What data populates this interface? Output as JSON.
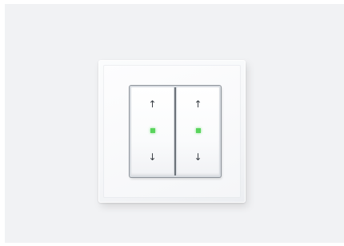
{
  "switch": {
    "rockers": [
      {
        "up_symbol": "↑",
        "down_symbol": "↓",
        "led_color": "#59d45c"
      },
      {
        "up_symbol": "↑",
        "down_symbol": "↓",
        "led_color": "#59d45c"
      }
    ],
    "frame_color": "#f6f7f9",
    "background_color": "#f1f2f4"
  }
}
